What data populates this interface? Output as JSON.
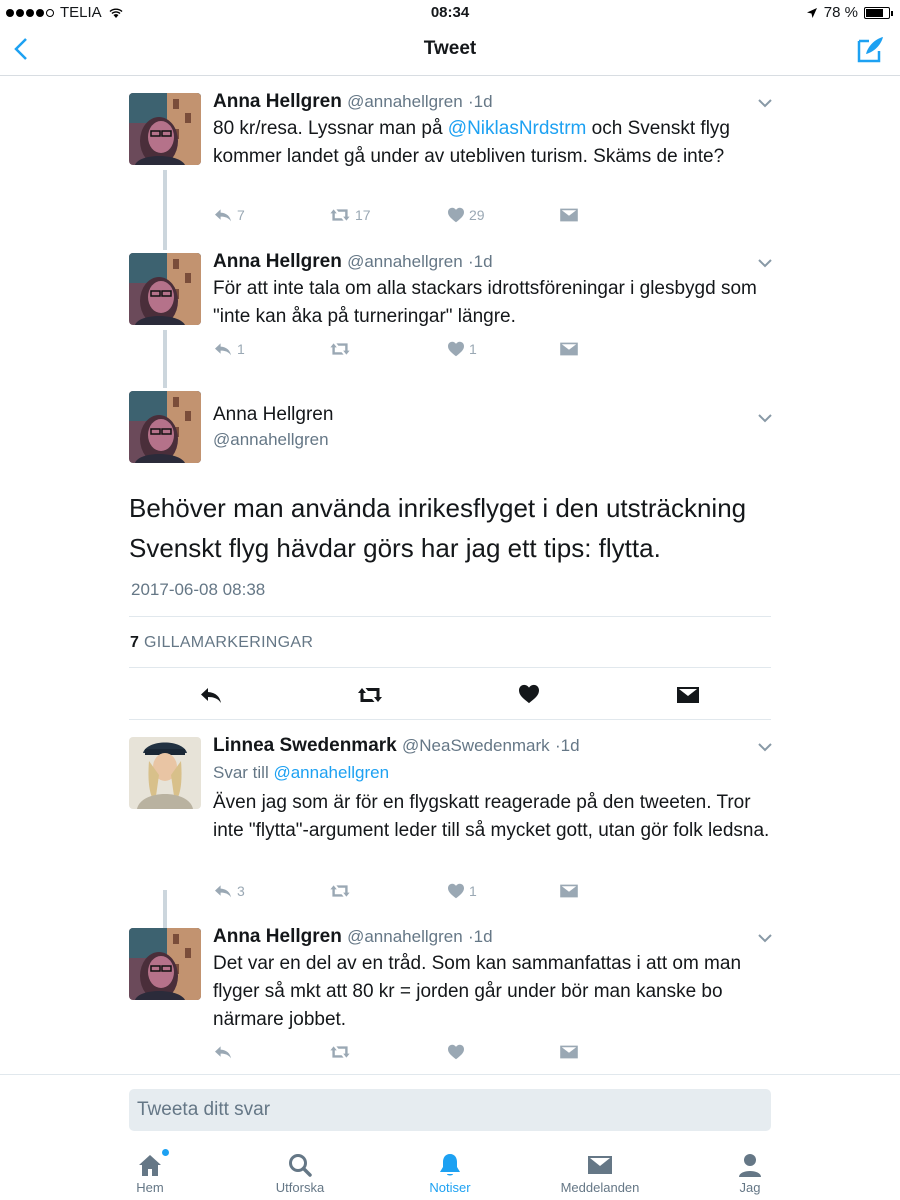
{
  "status_bar": {
    "carrier": "TELIA",
    "time": "08:34",
    "battery": "78 %",
    "battery_level": 0.78
  },
  "nav": {
    "title": "Tweet"
  },
  "tweets": [
    {
      "name": "Anna Hellgren",
      "handle": "@annahellgren",
      "age": "1d",
      "text_before": "80 kr/resa. Lyssnar man på ",
      "mention": "@NiklasNrdstrm",
      "text_after": " och Svenskt flyg kommer landet gå under av utebliven turism. Skäms de inte?",
      "replies": "7",
      "retweets": "17",
      "likes": "29"
    },
    {
      "name": "Anna Hellgren",
      "handle": "@annahellgren",
      "age": "1d",
      "text": "För att inte tala om alla stackars idrottsföreningar i glesbygd som \"inte kan åka på turneringar\" längre.",
      "replies": "1",
      "retweets": "",
      "likes": "1"
    }
  ],
  "main_tweet": {
    "name": "Anna Hellgren",
    "handle": "@annahellgren",
    "text": "Behöver man använda inrikesflyget i den utsträckning Svenskt flyg hävdar görs har jag ett tips: flytta.",
    "timestamp": "2017-06-08 08:38",
    "likes_count": "7",
    "likes_label": "GILLAMARKERINGAR"
  },
  "replies": [
    {
      "name": "Linnea Swedenmark",
      "handle": "@NeaSwedenmark",
      "age": "1d",
      "reply_to_prefix": "Svar till ",
      "reply_to": "@annahellgren",
      "text": "Även jag som är för en flygskatt reagerade på den tweeten. Tror inte \"flytta\"-argument leder till så mycket gott, utan gör folk ledsna.",
      "replies": "3",
      "retweets": "",
      "likes": "1"
    },
    {
      "name": "Anna Hellgren",
      "handle": "@annahellgren",
      "age": "1d",
      "text": "Det var en del av en tråd. Som kan sammanfattas i att om man flyger så mkt att 80 kr = jorden går under bör man kanske bo närmare jobbet.",
      "replies": "",
      "retweets": "",
      "likes": ""
    }
  ],
  "reply_input": {
    "placeholder": "Tweeta ditt svar"
  },
  "tabs": [
    {
      "label": "Hem",
      "icon": "home-icon"
    },
    {
      "label": "Utforska",
      "icon": "search-icon"
    },
    {
      "label": "Notiser",
      "icon": "bell-icon"
    },
    {
      "label": "Meddelanden",
      "icon": "envelope-icon"
    },
    {
      "label": "Jag",
      "icon": "person-icon"
    }
  ],
  "colors": {
    "accent": "#1da1f2",
    "muted": "#657786",
    "action": "#9aa8b4"
  }
}
